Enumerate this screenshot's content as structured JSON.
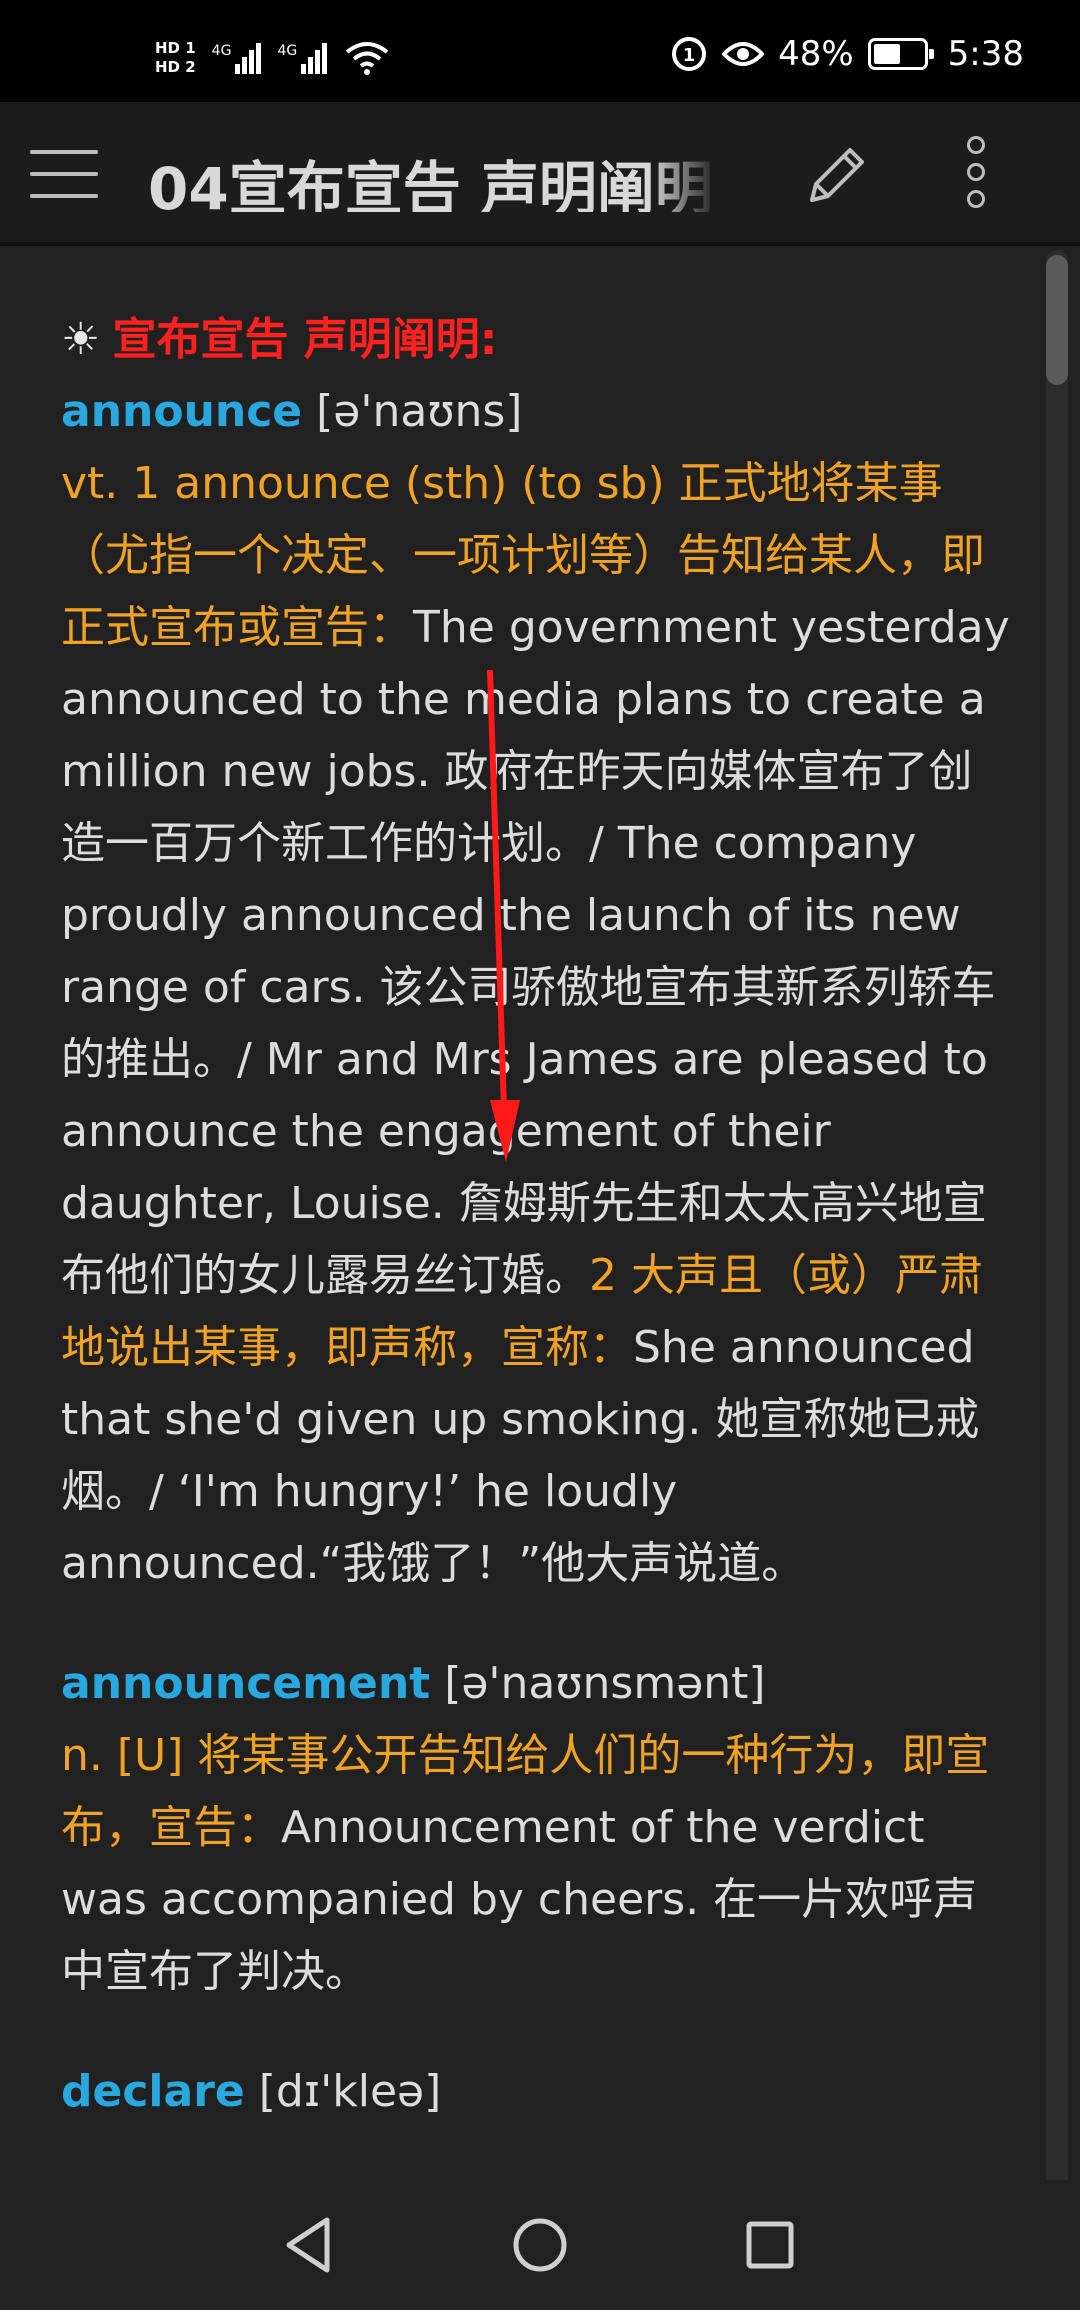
{
  "status_bar": {
    "hd1": "HD 1",
    "hd2": "HD 2",
    "net1": "4G",
    "net2": "4G",
    "battery": "48%",
    "time": "5:38"
  },
  "toolbar": {
    "title": "04宣布宣告 声明阐明"
  },
  "content": {
    "heading_icon": "☀",
    "heading": "宣布宣告 声明阐明:",
    "entries": [
      {
        "word": "announce",
        "phonetic": "[ə'naʊns]",
        "def1": "vt. 1 announce (sth) (to sb) 正式地将某事（尤指一个决定、一项计划等）告知给某人，即正式宣布或宣告：",
        "ex1": "The government yesterday announced to the media plans to create a million new jobs. 政府在昨天向媒体宣布了创造一百万个新工作的计划。/ The company proudly announced the launch of its new range of cars. 该公司骄傲地宣布其新系列轿车的推出。/ Mr and Mrs James are pleased to announce the engagement of their daughter, Louise. 詹姆斯先生和太太高兴地宣布他们的女儿露易丝订婚。",
        "def2": "2 大声且（或）严肃地说出某事，即声称，宣称：",
        "ex2": "She announced that she'd given up smoking. 她宣称她已戒烟。/ ‘I'm hungry!’ he loudly announced.“我饿了！”他大声说道。"
      },
      {
        "word": "announcement",
        "phonetic": "[ə'naʊnsmənt]",
        "def1": "n. [U] 将某事公开告知给人们的一种行为，即宣布，宣告：",
        "ex1": "Announcement of the verdict was accompanied by cheers. 在一片欢呼声中宣布了判决。"
      },
      {
        "word": "declare",
        "phonetic": "[dɪ'kleə]"
      }
    ]
  },
  "icons": {
    "menu": "hamburger-icon",
    "edit": "pencil-icon",
    "more": "more-vert-icon",
    "back": "back-triangle-icon",
    "home": "home-circle-icon",
    "recents": "recents-square-icon"
  },
  "colors": {
    "background": "#212121",
    "heading": "#ff2020",
    "word": "#29a8df",
    "definition": "#f0a225",
    "text": "#dcdcdc",
    "annotation_arrow": "#ff1a1a"
  }
}
